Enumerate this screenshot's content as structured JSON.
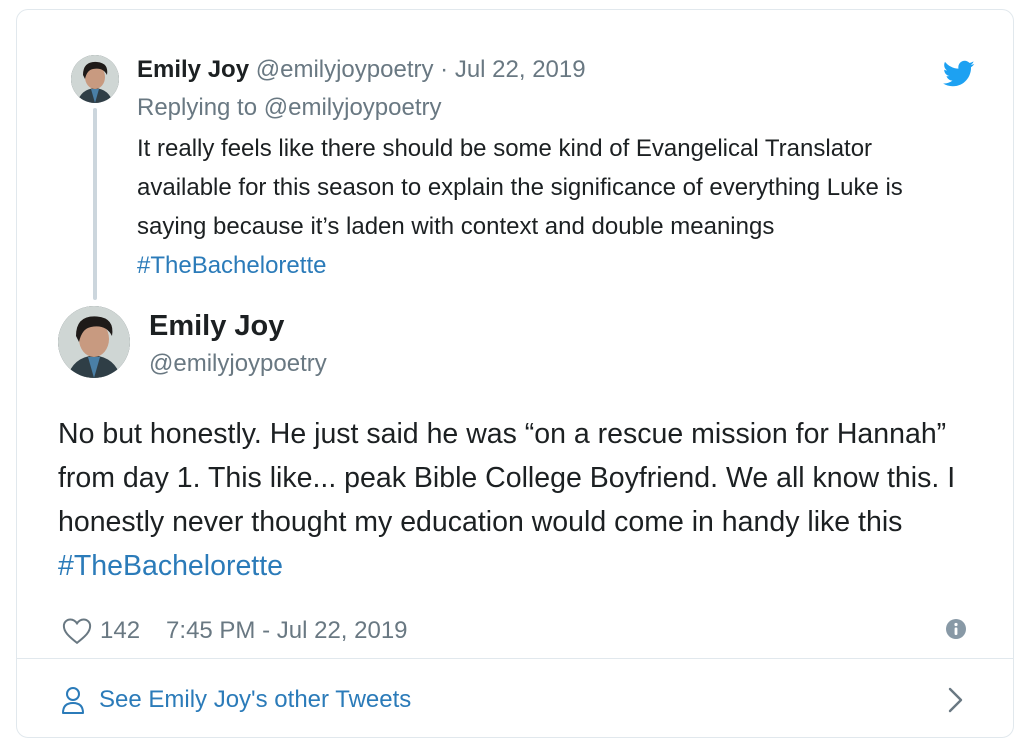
{
  "quoted_tweet": {
    "author_name": "Emily Joy",
    "handle": "@emilyjoypoetry",
    "separator": "·",
    "date": "Jul 22, 2019",
    "replying_prefix": "Replying to",
    "replying_to": "@emilyjoypoetry",
    "text": "It really feels like there should be some kind of Evangelical Translator available for this season to explain the significance of everything Luke is saying because it’s laden with context and double meanings ",
    "hashtag": "#TheBachelorette"
  },
  "main_tweet": {
    "author_name": "Emily Joy",
    "handle": "@emilyjoypoetry",
    "text": "No but honestly. He just said he was “on a rescue mission for Hannah” from day 1. This like... peak Bible College Boyfriend. We all know this. I honestly never thought my education would come in handy like this ",
    "hashtag": "#TheBachelorette",
    "likes": "142",
    "timestamp": "7:45 PM - Jul 22, 2019"
  },
  "footer": {
    "see_more_label": "See Emily Joy's other Tweets"
  },
  "icons": {
    "twitter": "twitter-bird-icon",
    "heart": "heart-icon",
    "info": "info-icon",
    "person": "person-icon",
    "chevron": "chevron-right-icon"
  },
  "colors": {
    "link": "#2b7bb9",
    "twitter_blue": "#1da1f2",
    "muted": "#697882",
    "text": "#1c2022",
    "border": "#e1e8ed"
  }
}
